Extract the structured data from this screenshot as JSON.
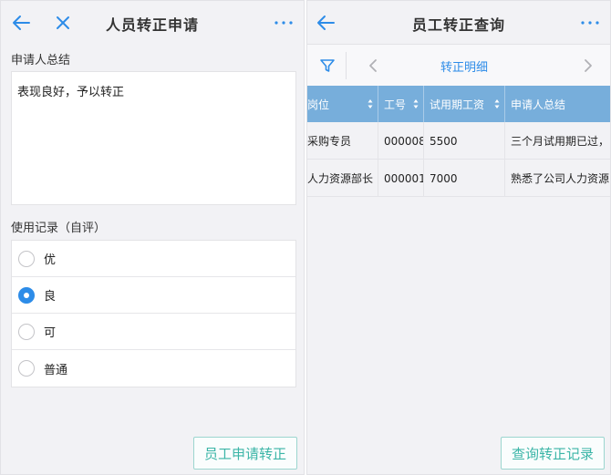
{
  "left": {
    "title": "人员转正申请",
    "summary_label": "申请人总结",
    "summary_text": "表现良好，予以转正",
    "record_label": "使用记录（自评）",
    "options": [
      {
        "label": "优",
        "checked": false
      },
      {
        "label": "良",
        "checked": true
      },
      {
        "label": "可",
        "checked": false
      },
      {
        "label": "普通",
        "checked": false
      }
    ],
    "action_label": "员工申请转正"
  },
  "right": {
    "title": "员工转正查询",
    "tab_title": "转正明细",
    "columns": [
      "岗位",
      "工号",
      "试用期工资",
      "申请人总结"
    ],
    "rows": [
      [
        "采购专员",
        "000008",
        "5500",
        "三个月试用期已过，"
      ],
      [
        "人力资源部长",
        "000001",
        "7000",
        "熟悉了公司人力资源"
      ]
    ],
    "action_label": "查询转正记录"
  },
  "colors": {
    "accent": "#2d8ce8",
    "table_header": "#77aedb",
    "action_text": "#3bb5a7",
    "action_border": "#9cd6cf"
  },
  "icons": [
    "back-arrow-icon",
    "close-icon",
    "more-icon",
    "filter-icon",
    "chevron-left-icon",
    "chevron-right-icon",
    "sort-icon",
    "radio-icon"
  ]
}
